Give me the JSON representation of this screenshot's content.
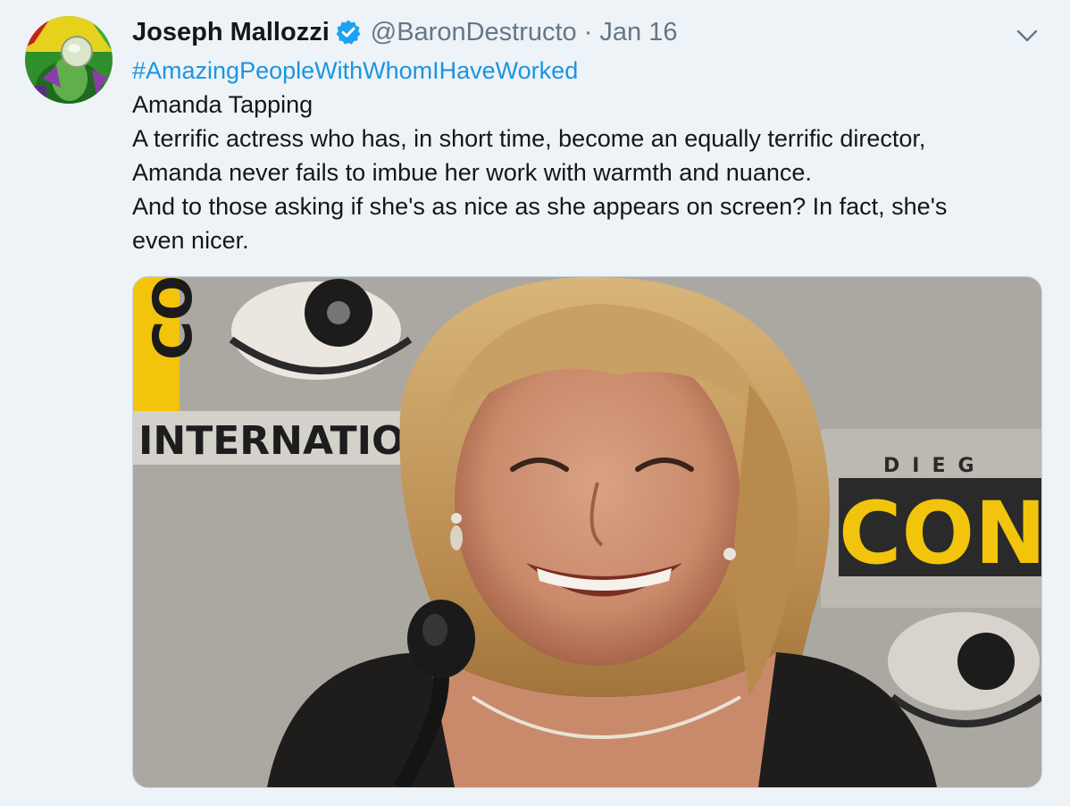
{
  "tweet": {
    "author_name": "Joseph Mallozzi",
    "handle": "@BaronDestructo",
    "separator": "·",
    "date": "Jan 16",
    "hashtag": "#AmazingPeopleWithWhomIHaveWorked",
    "lines": [
      "Amanda Tapping",
      "A terrific actress who has, in short time, become an equally terrific director,",
      "Amanda never fails to imbue her work with warmth and nuance.",
      "And to those asking if she's as nice as she appears on screen? In fact, she's",
      "even nicer."
    ]
  },
  "media": {
    "sign_left_top": "CO",
    "sign_left_bottom": "INTERNATIO",
    "sign_right_top": "DIEG",
    "sign_right_bottom": "CON"
  },
  "icons": {
    "avatar": "avatar-illustration",
    "verified": "verified-badge-icon",
    "caret": "chevron-down-icon"
  },
  "colors": {
    "background": "#eef3f7",
    "link": "#1b95e0",
    "muted": "#657786",
    "text": "#14171a",
    "verified": "#1da1f2"
  }
}
